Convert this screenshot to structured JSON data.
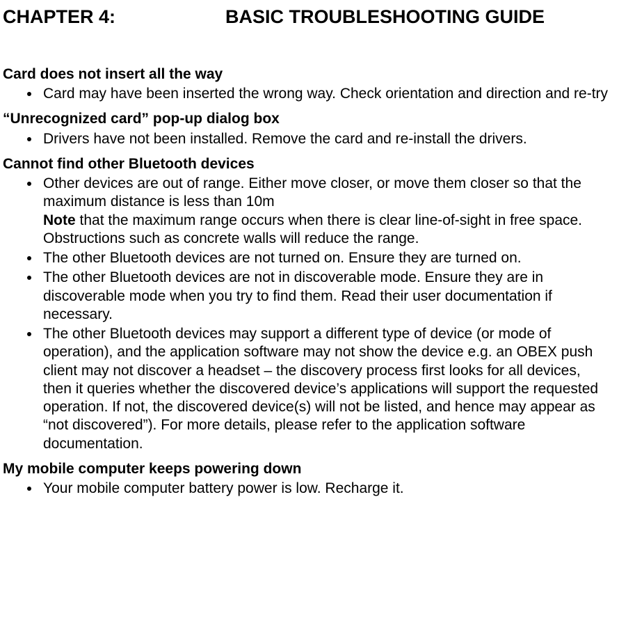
{
  "chapter": {
    "label": "CHAPTER 4:",
    "title": "BASIC TROUBLESHOOTING GUIDE"
  },
  "sections": [
    {
      "heading": "Card does not insert all the way",
      "items": [
        {
          "text": "Card may have been inserted the wrong way.  Check orientation and direction and re-try"
        }
      ]
    },
    {
      "heading": "“Unrecognized card” pop-up dialog box",
      "items": [
        {
          "text": "Drivers have not been installed.  Remove the card and re-install the drivers."
        }
      ]
    },
    {
      "heading": "Cannot find other Bluetooth devices",
      "items": [
        {
          "text": "Other devices are out of range.  Either move closer, or move them closer so that the maximum distance is less than 10m",
          "note_label": "Note",
          "note_text": " that the maximum range occurs when there is clear line-of-sight in free space.  Obstructions such as concrete walls will reduce the range."
        },
        {
          "text": "The other Bluetooth devices are not turned on.  Ensure they are turned on."
        },
        {
          "text": "The other Bluetooth devices are not in discoverable mode.  Ensure they are in discoverable mode when you try to find them.  Read their user documentation if necessary."
        },
        {
          "text": "The other Bluetooth devices may support a different type of device (or mode of operation), and the application software may not show the device e.g. an OBEX push client may not discover a headset – the discovery process first looks for all devices, then it queries whether the discovered device’s applications will support the requested operation.  If not, the discovered device(s) will not be listed, and hence may appear as “not discovered”).  For more details, please refer to the application software documentation."
        }
      ]
    },
    {
      "heading": "My mobile computer keeps powering down",
      "items": [
        {
          "text": "Your mobile computer battery power is low.  Recharge it."
        }
      ]
    }
  ]
}
